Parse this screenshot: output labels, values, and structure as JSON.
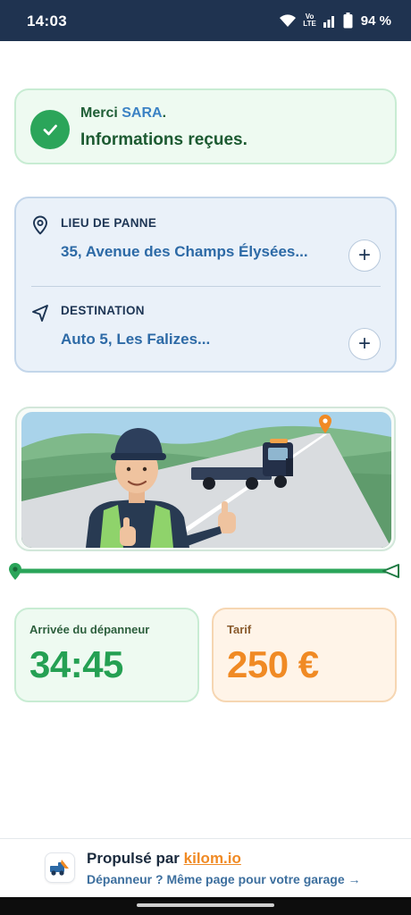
{
  "status_bar": {
    "time": "14:03",
    "volte": "Vo LTE",
    "battery_percent": "94 %"
  },
  "confirmation": {
    "greeting_prefix": "Merci",
    "user_name": "SARA",
    "greeting_suffix": ".",
    "message": "Informations reçues."
  },
  "route": {
    "breakdown": {
      "label": "LIEU DE PANNE",
      "value": "35, Avenue des Champs Élysées...",
      "icon": "location-pin-icon"
    },
    "destination": {
      "label": "DESTINATION",
      "value": "Auto 5, Les Falizes...",
      "icon": "navigation-arrow-icon"
    },
    "add_symbol": "+"
  },
  "illustration": {
    "description_icon": "tow-truck-mechanic-illustration"
  },
  "progress": {
    "value": 1.0,
    "color": "#2ba55a"
  },
  "eta": {
    "label": "Arrivée du dépanneur",
    "value": "34:45"
  },
  "price": {
    "label": "Tarif",
    "value": "250 €"
  },
  "footer": {
    "powered_prefix": "Propulsé par",
    "brand_link": "kilom.io",
    "cta": "Dépanneur ? Même page pour votre garage →"
  },
  "colors": {
    "success": "#2ba55a",
    "accent": "#f08a24",
    "primary_blue": "#2d6aa6",
    "status_bar": "#1f3350"
  }
}
